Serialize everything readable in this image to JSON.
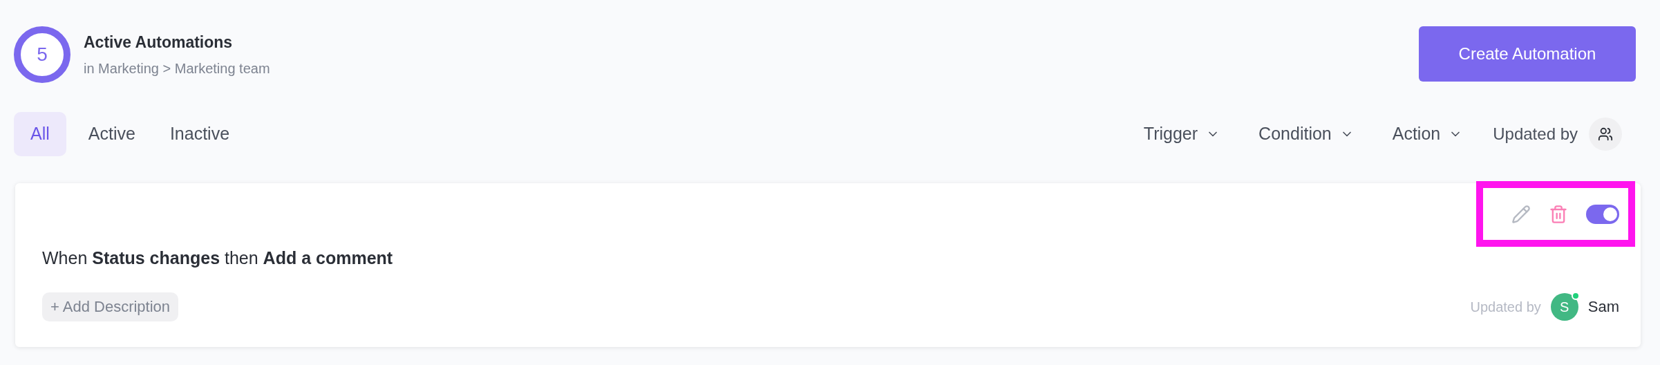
{
  "header": {
    "count": "5",
    "title": "Active Automations",
    "subtitle": "in Marketing > Marketing team",
    "create_button": "Create Automation"
  },
  "tabs": [
    {
      "label": "All",
      "selected": true
    },
    {
      "label": "Active",
      "selected": false
    },
    {
      "label": "Inactive",
      "selected": false
    }
  ],
  "filters": [
    {
      "label": "Trigger",
      "kind": "dropdown"
    },
    {
      "label": "Condition",
      "kind": "dropdown"
    },
    {
      "label": "Action",
      "kind": "dropdown"
    },
    {
      "label": "Updated by",
      "kind": "people"
    }
  ],
  "automations": [
    {
      "rule": "When **Status changes** then **Add a comment**",
      "add_description": "+ Add Description",
      "on": true,
      "highlighted": true,
      "updated_by_label": "Updated by",
      "user": {
        "initial": "S",
        "name": "Sam",
        "online": true
      }
    }
  ]
}
